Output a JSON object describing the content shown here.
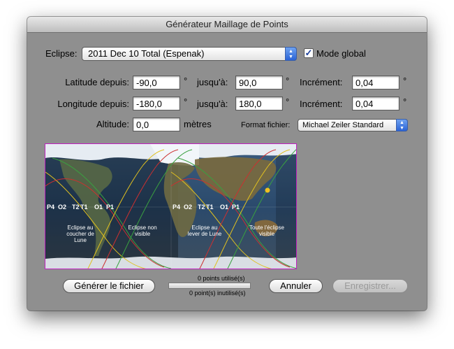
{
  "window": {
    "title": "Générateur Maillage de Points"
  },
  "eclipse": {
    "label": "Eclipse:",
    "selected": "2011 Dec 10 Total (Espenak)",
    "mode_global_label": "Mode global",
    "mode_global_checked": true
  },
  "latitude": {
    "label": "Latitude depuis:",
    "from": "-90,0",
    "unit": "°",
    "to_label": "jusqu'à:",
    "to": "90,0",
    "increment_label": "Incrément:",
    "increment": "0,04"
  },
  "longitude": {
    "label": "Longitude depuis:",
    "from": "-180,0",
    "unit": "°",
    "to_label": "jusqu'à:",
    "to": "180,0",
    "increment_label": "Incrément:",
    "increment": "0,04"
  },
  "altitude": {
    "label": "Altitude:",
    "value": "0,0",
    "unit": "mètres"
  },
  "format": {
    "label": "Format fichier:",
    "selected": "Michael Zeiler Standard"
  },
  "map": {
    "contact_labels_left": [
      "P4",
      "O2",
      "T2",
      "T1",
      "O1",
      "P1"
    ],
    "contact_labels_right": [
      "P4",
      "O2",
      "T2",
      "T1",
      "O1",
      "P1"
    ],
    "zones": [
      "Eclipse au coucher de Lune",
      "Eclipse non visible",
      "Eclipse au lever de Lune",
      "Toute l'éclipse visible"
    ]
  },
  "buttons": {
    "generate": "Générer le fichier",
    "cancel": "Annuler",
    "save": "Enregistrer..."
  },
  "status": {
    "used": "0 points utilisé(s)",
    "unused": "0 point(s) inutilisé(s)"
  },
  "icons": {
    "checkbox": "checkmark-icon",
    "popup": "updown-arrows-icon"
  }
}
